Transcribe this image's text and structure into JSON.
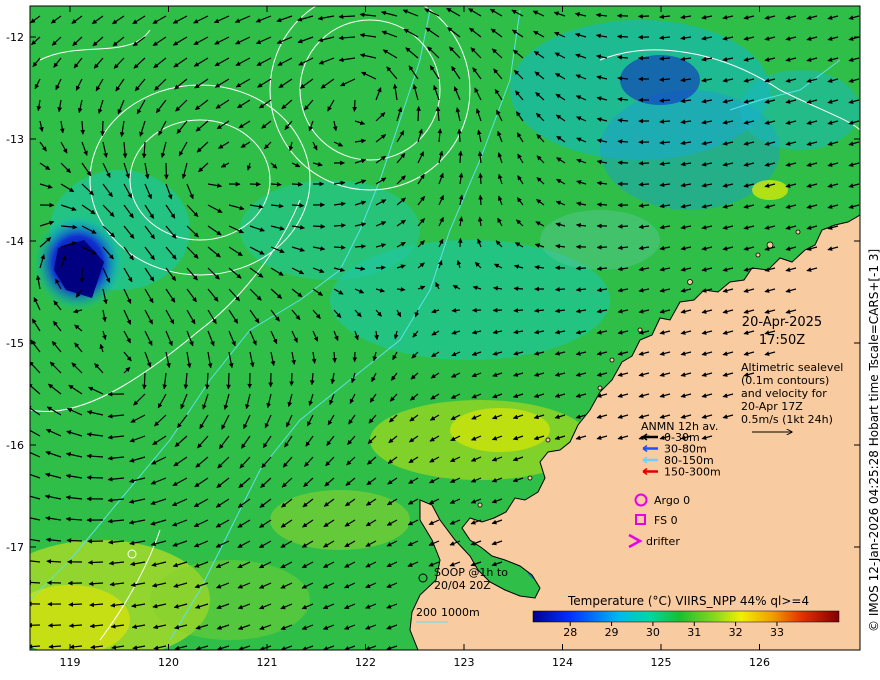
{
  "map": {
    "x_ticks": [
      "119",
      "120",
      "121",
      "122",
      "123",
      "124",
      "125",
      "126"
    ],
    "y_ticks": [
      "-12",
      "-13",
      "-14",
      "-15",
      "-16",
      "-17"
    ],
    "date_line": "20-Apr-2025",
    "time_line": "17:50Z",
    "altimetry_lines": [
      "Altimetric sealevel",
      "(0.1m contours)",
      "and velocity for",
      "20-Apr 17Z",
      "0.5m/s (1kt 24h)"
    ],
    "anmn_title": "ANMN 12h av.",
    "anmn_legend": [
      {
        "label": "0-30m",
        "color": "#000000"
      },
      {
        "label": "30-80m",
        "color": "#1f4fff"
      },
      {
        "label": "80-150m",
        "color": "#6fd0ff"
      },
      {
        "label": "150-300m",
        "color": "#e00000"
      }
    ],
    "argo_label": "Argo 0",
    "fs_label": "FS 0",
    "drifter_label": "drifter",
    "soop_lines": [
      "SOOP @1h to",
      "20/04 20Z"
    ],
    "bathy_label_a": "200",
    "bathy_label_b": "1000m",
    "colorbar_title": "Temperature (°C) VIIRS_NPP 44% ql>=4",
    "colorbar_ticks": [
      "28",
      "29",
      "30",
      "31",
      "32",
      "33"
    ],
    "side_credit": "© IMOS 12-Jan-2026 04:25:28 Hobart time Tscale=CARS+[-1 3]",
    "colors": {
      "land": "#f8cba0",
      "ocean_base": "#2fbf48",
      "marker_magenta": "#e600e6",
      "contour_white": "#ffffff",
      "contour_cyan": "#5fe0e8"
    }
  }
}
